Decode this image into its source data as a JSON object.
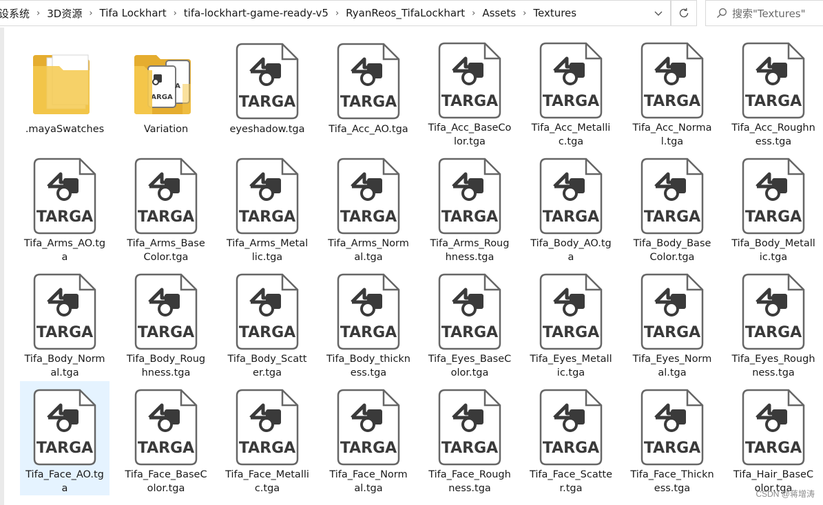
{
  "breadcrumbs": [
    "设系统",
    "3D资源",
    "Tifa Lockhart",
    "tifa-lockhart-game-ready-v5",
    "RyanReos_TifaLockhart",
    "Assets",
    "Textures"
  ],
  "search": {
    "placeholder": "搜索\"Textures\""
  },
  "icons": {
    "address_dropdown": "chevron-down-icon",
    "refresh": "refresh-icon",
    "search": "search-icon",
    "folder": "folder-icon",
    "tga_file": "targa-file-icon"
  },
  "file_badge": "TARGA",
  "items": [
    {
      "name": ".mayaSwatches",
      "type": "folder"
    },
    {
      "name": "Variation",
      "type": "folder-targa"
    },
    {
      "name": "eyeshadow.tga",
      "type": "tga"
    },
    {
      "name": "Tifa_Acc_AO.tga",
      "type": "tga"
    },
    {
      "name": "Tifa_Acc_BaseColor.tga",
      "type": "tga"
    },
    {
      "name": "Tifa_Acc_Metallic.tga",
      "type": "tga"
    },
    {
      "name": "Tifa_Acc_Normal.tga",
      "type": "tga"
    },
    {
      "name": "Tifa_Acc_Roughness.tga",
      "type": "tga"
    },
    {
      "name": "Tifa_Arms_AO.tga",
      "type": "tga"
    },
    {
      "name": "Tifa_Arms_BaseColor.tga",
      "type": "tga"
    },
    {
      "name": "Tifa_Arms_Metallic.tga",
      "type": "tga"
    },
    {
      "name": "Tifa_Arms_Normal.tga",
      "type": "tga"
    },
    {
      "name": "Tifa_Arms_Roughness.tga",
      "type": "tga"
    },
    {
      "name": "Tifa_Body_AO.tga",
      "type": "tga"
    },
    {
      "name": "Tifa_Body_BaseColor.tga",
      "type": "tga"
    },
    {
      "name": "Tifa_Body_Metallic.tga",
      "type": "tga"
    },
    {
      "name": "Tifa_Body_Normal.tga",
      "type": "tga"
    },
    {
      "name": "Tifa_Body_Roughness.tga",
      "type": "tga"
    },
    {
      "name": "Tifa_Body_Scatter.tga",
      "type": "tga"
    },
    {
      "name": "Tifa_Body_thickness.tga",
      "type": "tga"
    },
    {
      "name": "Tifa_Eyes_BaseColor.tga",
      "type": "tga"
    },
    {
      "name": "Tifa_Eyes_Metallic.tga",
      "type": "tga"
    },
    {
      "name": "Tifa_Eyes_Normal.tga",
      "type": "tga"
    },
    {
      "name": "Tifa_Eyes_Roughness.tga",
      "type": "tga"
    },
    {
      "name": "Tifa_Face_AO.tga",
      "type": "tga",
      "selected": true
    },
    {
      "name": "Tifa_Face_BaseColor.tga",
      "type": "tga"
    },
    {
      "name": "Tifa_Face_Metallic.tga",
      "type": "tga"
    },
    {
      "name": "Tifa_Face_Normal.tga",
      "type": "tga"
    },
    {
      "name": "Tifa_Face_Roughness.tga",
      "type": "tga"
    },
    {
      "name": "Tifa_Face_Scatter.tga",
      "type": "tga"
    },
    {
      "name": "Tifa_Face_Thickness.tga",
      "type": "tga"
    },
    {
      "name": "Tifa_Hair_BaseColor.tga",
      "type": "tga"
    }
  ],
  "colors": {
    "selection": "#e5f3ff",
    "folder": "#f5c94e",
    "file_body": "#ffffff",
    "file_border": "#666666"
  },
  "watermark": "CSDN @蒋增涛"
}
